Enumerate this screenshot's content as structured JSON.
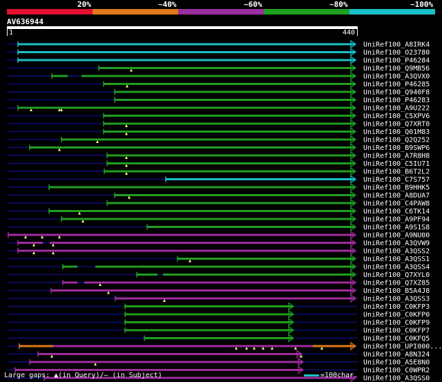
{
  "legend": {
    "ticks": [
      "20%",
      "~40%",
      "~60%",
      "~80%",
      "~100%"
    ],
    "colors": [
      "#e0102e",
      "#e07a1a",
      "#9a2fa0",
      "#20a020",
      "#19c0c8"
    ]
  },
  "query": {
    "title": "AV636944",
    "start": "1",
    "end": "440"
  },
  "colors": {
    "cyan": "#19c0c8",
    "green": "#20a020",
    "magenta": "#a02ca0",
    "orange": "#e07a1a",
    "gap": "#0a0a60",
    "marker": "#ffff88"
  },
  "hits": [
    {
      "label": "UniRef100_A8IRK4",
      "segs": [
        [
          26,
          514,
          "cyan"
        ]
      ],
      "markers": []
    },
    {
      "label": "UniRef100_O23780",
      "segs": [
        [
          26,
          514,
          "cyan"
        ]
      ],
      "markers": []
    },
    {
      "label": "UniRef100_P46284",
      "segs": [
        [
          26,
          514,
          "cyan"
        ]
      ],
      "markers": []
    },
    {
      "label": "UniRef100_Q9MB56",
      "segs": [
        [
          143,
          514,
          "green"
        ]
      ],
      "markers": [
        190
      ]
    },
    {
      "label": "UniRef100_A3QVX0",
      "segs": [
        [
          75,
          98,
          "green"
        ],
        [
          98,
          118,
          "gap"
        ],
        [
          118,
          514,
          "green"
        ]
      ],
      "markers": []
    },
    {
      "label": "UniRef100_P46285",
      "segs": [
        [
          150,
          514,
          "green"
        ]
      ],
      "markers": [
        184
      ]
    },
    {
      "label": "UniRef100_Q940F8",
      "segs": [
        [
          166,
          514,
          "green"
        ]
      ],
      "markers": []
    },
    {
      "label": "UniRef100_P46283",
      "segs": [
        [
          166,
          514,
          "green"
        ]
      ],
      "markers": []
    },
    {
      "label": "UniRef100_A9U222",
      "segs": [
        [
          26,
          514,
          "green"
        ]
      ],
      "markers": [
        45,
        86,
        89
      ]
    },
    {
      "label": "UniRef100_C5XPV6",
      "segs": [
        [
          150,
          514,
          "green"
        ]
      ],
      "markers": []
    },
    {
      "label": "UniRef100_Q7XRT0",
      "segs": [
        [
          150,
          514,
          "green"
        ]
      ],
      "markers": [
        183
      ]
    },
    {
      "label": "UniRef100_Q01M83",
      "segs": [
        [
          150,
          514,
          "green"
        ]
      ],
      "markers": [
        183
      ]
    },
    {
      "label": "UniRef100_Q2Q252",
      "segs": [
        [
          89,
          514,
          "green"
        ]
      ],
      "markers": [
        141
      ]
    },
    {
      "label": "UniRef100_B9SWP6",
      "segs": [
        [
          43,
          514,
          "green"
        ]
      ],
      "markers": [
        86
      ]
    },
    {
      "label": "UniRef100_A7R8H8",
      "segs": [
        [
          155,
          514,
          "green"
        ]
      ],
      "markers": [
        183
      ]
    },
    {
      "label": "UniRef100_C5IU71",
      "segs": [
        [
          155,
          514,
          "green"
        ]
      ],
      "markers": [
        183
      ]
    },
    {
      "label": "UniRef100_B6T2L2",
      "segs": [
        [
          151,
          514,
          "green"
        ]
      ],
      "markers": [
        183
      ]
    },
    {
      "label": "UniRef100_C7S757",
      "segs": [
        [
          240,
          514,
          "cyan"
        ]
      ],
      "markers": []
    },
    {
      "label": "UniRef100_B9HHK5",
      "segs": [
        [
          71,
          514,
          "green"
        ]
      ],
      "markers": []
    },
    {
      "label": "UniRef100_A8DUA7",
      "segs": [
        [
          166,
          514,
          "green"
        ]
      ],
      "markers": [
        187
      ]
    },
    {
      "label": "UniRef100_C4PAW8",
      "segs": [
        [
          155,
          514,
          "green"
        ]
      ],
      "markers": []
    },
    {
      "label": "UniRef100_C6TK14",
      "segs": [
        [
          71,
          514,
          "green"
        ]
      ],
      "markers": [
        115
      ]
    },
    {
      "label": "UniRef100_A9PF94",
      "segs": [
        [
          89,
          514,
          "green"
        ]
      ],
      "markers": [
        120
      ]
    },
    {
      "label": "UniRef100_A9S1S8",
      "segs": [
        [
          213,
          514,
          "green"
        ]
      ],
      "markers": []
    },
    {
      "label": "UniRef100_A9NU00",
      "segs": [
        [
          12,
          514,
          "magenta"
        ]
      ],
      "markers": [
        37,
        61,
        86
      ]
    },
    {
      "label": "UniRef100_A3QVW9",
      "segs": [
        [
          26,
          62,
          "magenta"
        ],
        [
          62,
          72,
          "gap"
        ],
        [
          72,
          514,
          "magenta"
        ]
      ],
      "markers": [
        49,
        77
      ]
    },
    {
      "label": "UniRef100_A3QSS2",
      "segs": [
        [
          26,
          514,
          "magenta"
        ]
      ],
      "markers": [
        49,
        77
      ]
    },
    {
      "label": "UniRef100_A3QSS1",
      "segs": [
        [
          257,
          514,
          "green"
        ]
      ],
      "markers": [
        275
      ]
    },
    {
      "label": "UniRef100_A3QSS4",
      "segs": [
        [
          91,
          112,
          "green"
        ],
        [
          112,
          138,
          "gap"
        ],
        [
          138,
          514,
          "green"
        ]
      ],
      "markers": []
    },
    {
      "label": "UniRef100_Q7XYL0",
      "segs": [
        [
          198,
          228,
          "green"
        ],
        [
          228,
          236,
          "gap"
        ],
        [
          236,
          514,
          "green"
        ]
      ],
      "markers": []
    },
    {
      "label": "UniRef100_Q7XZ85",
      "segs": [
        [
          91,
          112,
          "magenta"
        ],
        [
          112,
          122,
          "gap"
        ],
        [
          122,
          514,
          "magenta"
        ]
      ],
      "markers": [
        145
      ]
    },
    {
      "label": "UniRef100_B5A4J8",
      "segs": [
        [
          74,
          514,
          "magenta"
        ]
      ],
      "markers": [
        157
      ]
    },
    {
      "label": "UniRef100_A3QSS3",
      "segs": [
        [
          167,
          514,
          "magenta"
        ]
      ],
      "markers": [
        238
      ]
    },
    {
      "label": "UniRef100_C0KFP3",
      "segs": [
        [
          181,
          424,
          "green"
        ]
      ],
      "markers": []
    },
    {
      "label": "UniRef100_C0KFP0",
      "segs": [
        [
          181,
          424,
          "green"
        ]
      ],
      "markers": []
    },
    {
      "label": "UniRef100_C0KFP9",
      "segs": [
        [
          181,
          424,
          "green"
        ]
      ],
      "markers": []
    },
    {
      "label": "UniRef100_C0KFP7",
      "segs": [
        [
          181,
          424,
          "green"
        ]
      ],
      "markers": []
    },
    {
      "label": "UniRef100_C0KFQ5",
      "segs": [
        [
          209,
          424,
          "green"
        ]
      ],
      "markers": []
    },
    {
      "label": "UniRef100_UPI000...",
      "segs": [
        [
          28,
          77,
          "orange"
        ],
        [
          77,
          453,
          "magenta"
        ],
        [
          453,
          514,
          "orange"
        ]
      ],
      "markers": [
        342,
        357,
        368,
        381,
        394,
        428,
        466
      ]
    },
    {
      "label": "UniRef100_A8N324",
      "segs": [
        [
          55,
          436,
          "magenta"
        ]
      ],
      "markers": [
        75,
        436
      ]
    },
    {
      "label": "UniRef100_A5E8N0",
      "segs": [
        [
          43,
          438,
          "magenta"
        ]
      ],
      "markers": [
        138
      ]
    },
    {
      "label": "UniRef100_C0WPR2",
      "segs": [
        [
          22,
          438,
          "magenta"
        ]
      ],
      "markers": []
    },
    {
      "label": "UniRef100_A3QSS0",
      "segs": [
        [
          64,
          514,
          "magenta"
        ]
      ],
      "markers": []
    }
  ],
  "footer": {
    "gaps_text": "Large gaps: ▲(in Query)/– (in Subject)",
    "scale_text": "=100char."
  }
}
